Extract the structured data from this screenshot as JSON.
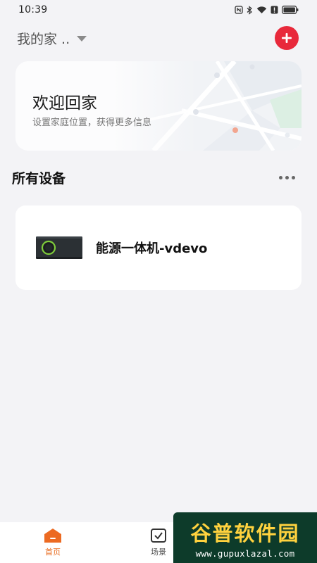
{
  "status_bar": {
    "time": "10:39",
    "icons": [
      "nfc-icon",
      "bluetooth-icon",
      "wifi-icon",
      "alert-icon",
      "battery-icon"
    ]
  },
  "header": {
    "home_name": "我的家 ..",
    "add_icon": "plus-icon",
    "accent_color": "#e8293b"
  },
  "welcome_card": {
    "title": "欢迎回家",
    "subtitle": "设置家庭位置，获得更多信息"
  },
  "devices_section": {
    "title": "所有设备",
    "more_icon": "more-dots-icon",
    "devices": [
      {
        "name": "能源一体机-vdevo",
        "icon": "energy-unit-icon"
      }
    ]
  },
  "bottom_nav": {
    "items": [
      {
        "label": "首页",
        "icon": "home-icon",
        "active": true
      },
      {
        "label": "场景",
        "icon": "scene-check-icon",
        "active": false
      }
    ],
    "active_color": "#e86b1f"
  },
  "watermark": {
    "title": "谷普软件园",
    "url": "www.gupuxlazal.com"
  }
}
